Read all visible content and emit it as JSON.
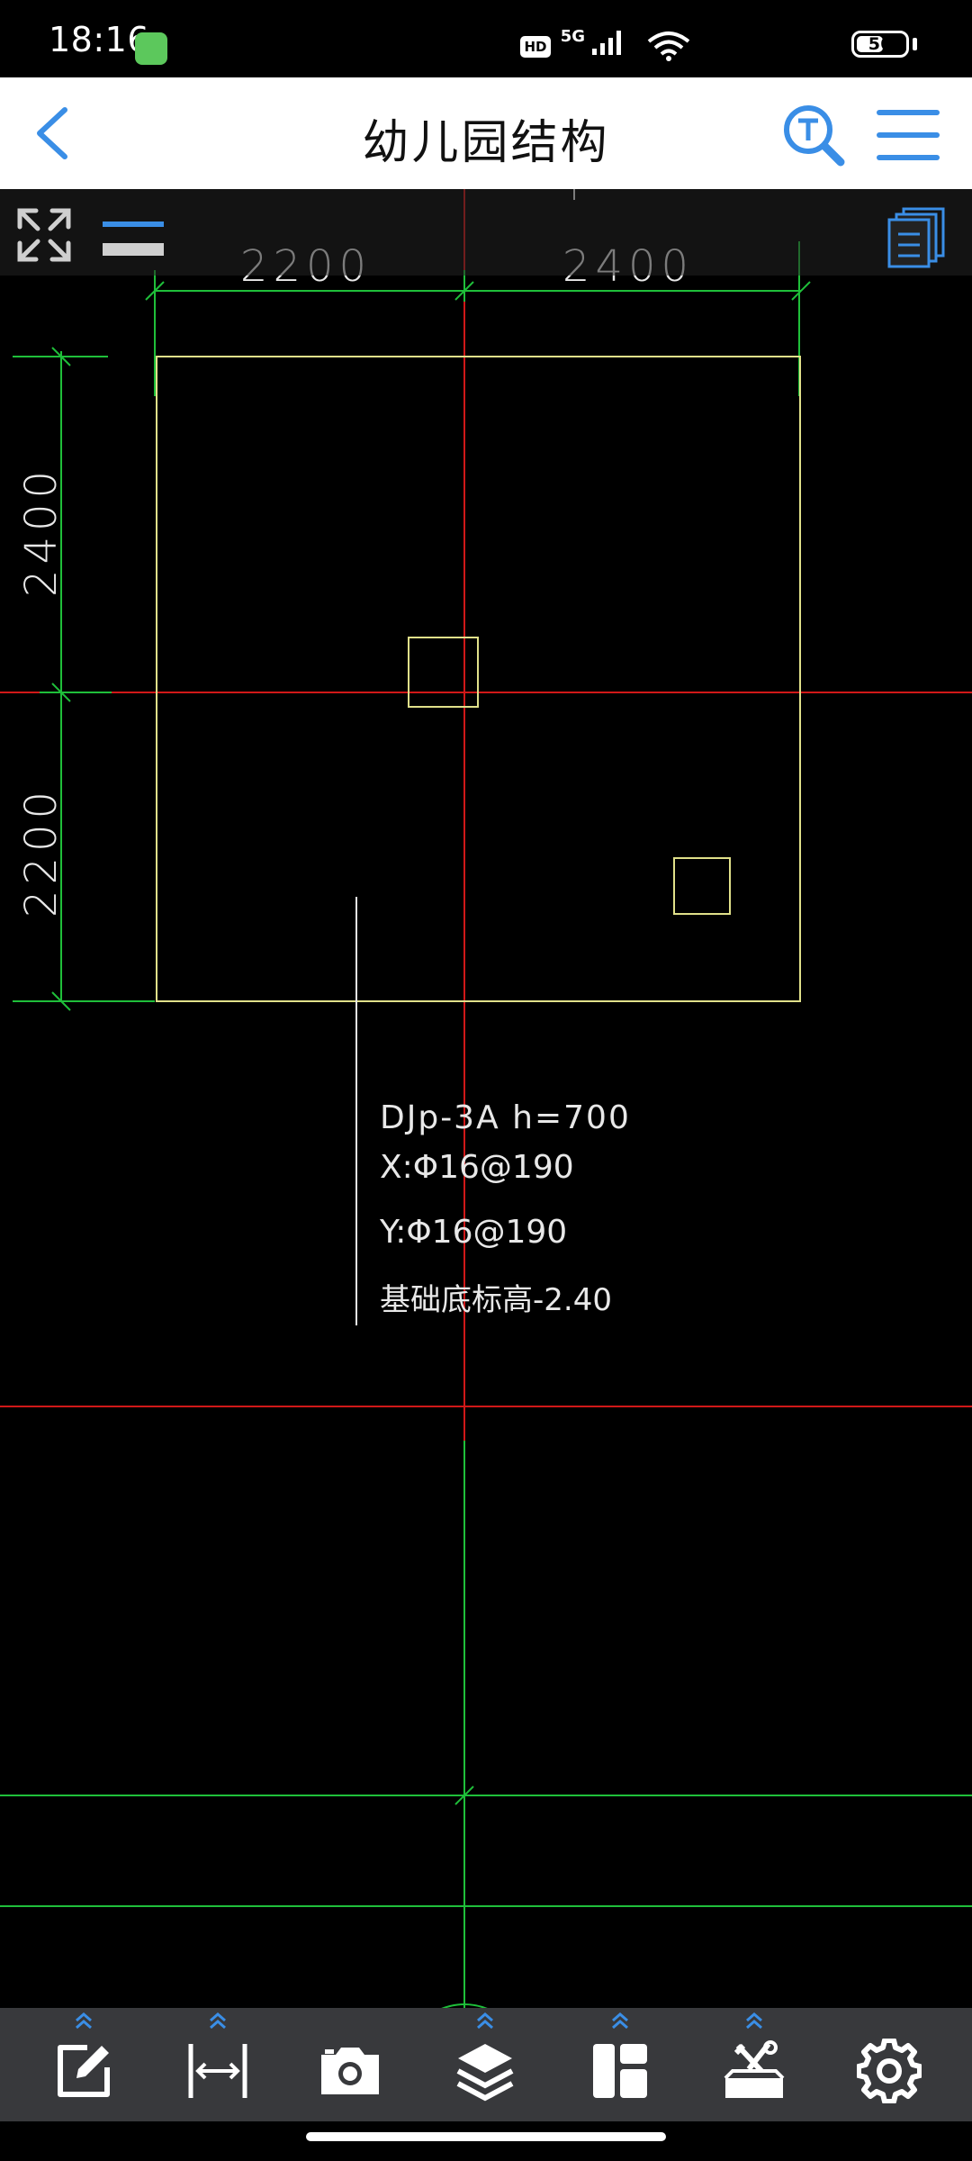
{
  "status_bar": {
    "time": "18:16",
    "hd_label": "HD",
    "network_label": "5G",
    "battery_percent": "56",
    "battery_level": 0.56
  },
  "header": {
    "title": "幼儿园结构",
    "back_icon": "chevron-left-icon",
    "search_icon": "text-search-icon",
    "menu_icon": "hamburger-menu-icon"
  },
  "drawing": {
    "dim_top_left": "2200",
    "dim_top_right": "2400",
    "dim_left_upper": "2400",
    "dim_left_lower": "2200",
    "note_line1": "DJp-3A h=700",
    "note_line2": "X:Φ16@190",
    "note_line3": "Y:Φ16@190",
    "note_line4": "基础底标高-2.40",
    "colors": {
      "axis_red": "#d01818",
      "dimension_green": "#1fbf3a",
      "outline_yellow": "#e0e08a",
      "text_white": "#e8e8e8"
    }
  },
  "toolbar_overlay": {
    "fullscreen_icon": "fullscreen-arrows-icon",
    "line_weight_icon": "line-weight-icon",
    "layouts_icon": "layouts-stack-icon"
  },
  "bottom_tools": [
    {
      "name": "edit",
      "icon": "edit-note-icon"
    },
    {
      "name": "measure",
      "icon": "measure-distance-icon"
    },
    {
      "name": "screenshot",
      "icon": "camera-icon"
    },
    {
      "name": "layers",
      "icon": "layers-icon"
    },
    {
      "name": "layout",
      "icon": "layout-panels-icon"
    },
    {
      "name": "tools",
      "icon": "toolbox-icon"
    },
    {
      "name": "settings",
      "icon": "gear-icon"
    }
  ],
  "accent_color": "#3a8ee6"
}
